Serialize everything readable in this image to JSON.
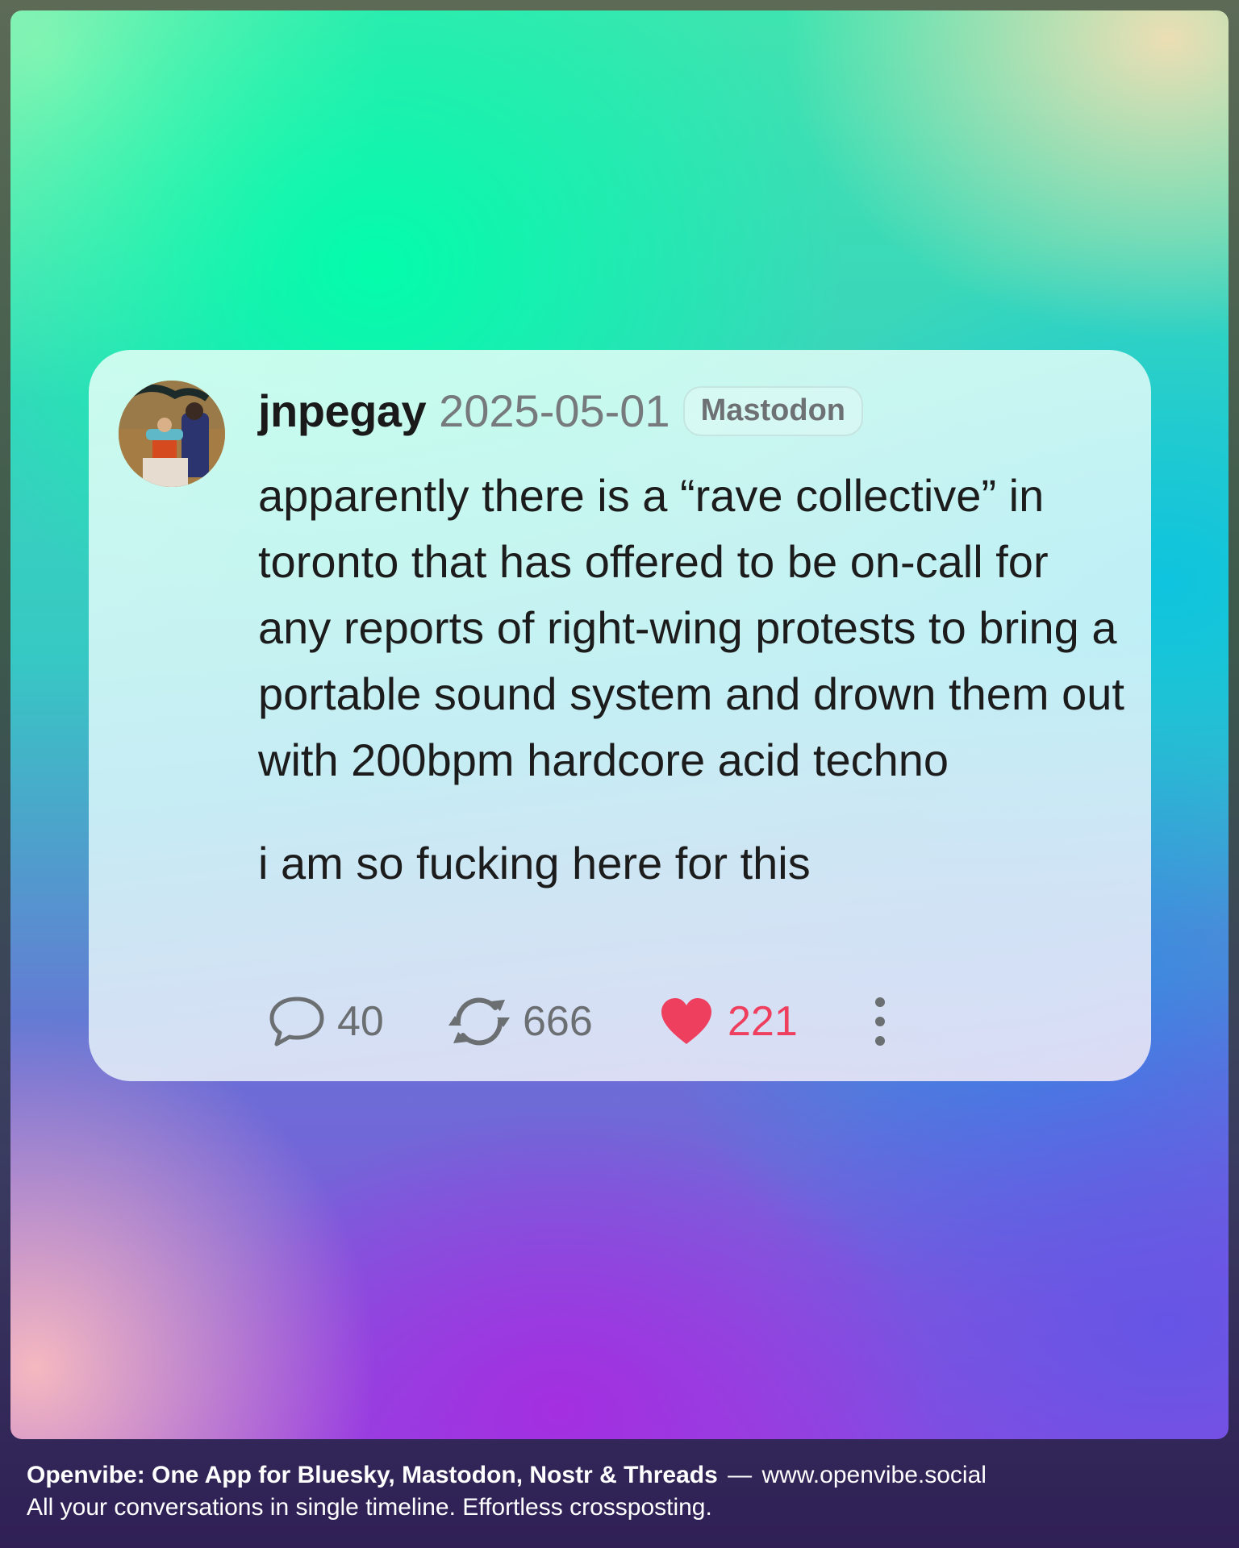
{
  "post": {
    "username": "jnpegay",
    "date": "2025-05-01",
    "network": "Mastodon",
    "paragraphs": [
      "apparently there is a “rave collective” in toronto that has offered to be on-call for any reports of right-wing protests to bring a portable sound system and drown them out with 200bpm hardcore acid techno",
      "i am so fucking here for this"
    ],
    "reply_count": "40",
    "repost_count": "666",
    "like_count": "221",
    "icons": {
      "reply": "speech-bubble-icon",
      "repost": "refresh-arrows-icon",
      "like": "heart-icon",
      "more": "vertical-ellipsis-icon"
    }
  },
  "footer": {
    "brand_line": "Openvibe: One App for Bluesky, Mastodon, Nostr & Threads",
    "separator": "—",
    "url": "www.openvibe.social",
    "tagline": "All your conversations in single timeline. Effortless crossposting."
  },
  "colors": {
    "like_accent": "#ee3f5e",
    "text_primary": "#1c1c1c",
    "text_muted": "#777a7c"
  }
}
